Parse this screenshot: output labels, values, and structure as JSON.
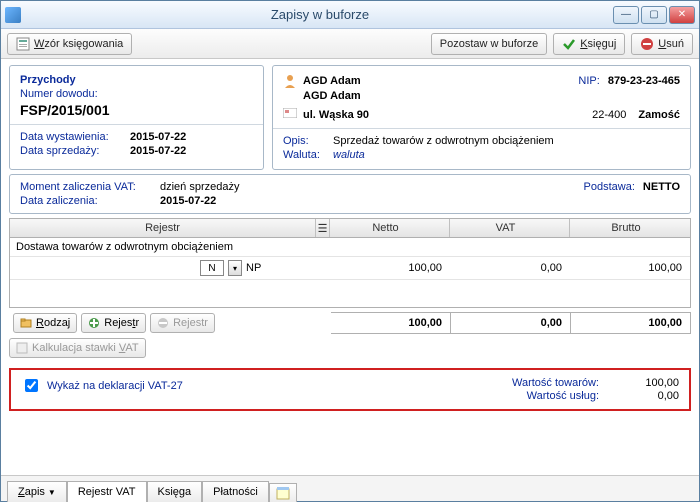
{
  "window": {
    "title": "Zapisy w buforze"
  },
  "toolbar": {
    "wzor": "Wzór księgowania",
    "pozostaw": "Pozostaw w buforze",
    "ksieguj": "Księguj",
    "usun": "Usuń"
  },
  "left_panel": {
    "przychody": "Przychody",
    "numer_label": "Numer dowodu:",
    "numer_value": "FSP/2015/001",
    "data_wyst_label": "Data wystawienia:",
    "data_wyst_value": "2015-07-22",
    "data_sprz_label": "Data sprzedaży:",
    "data_sprz_value": "2015-07-22"
  },
  "right_panel": {
    "name1": "AGD Adam",
    "nip_label": "NIP:",
    "nip_value": "879-23-23-465",
    "name2": "AGD Adam",
    "street": "ul. Wąska 90",
    "zip": "22-400",
    "city": "Zamość",
    "opis_label": "Opis:",
    "opis_value": "Sprzedaż towarów z odwrotnym obciążeniem",
    "waluta_label": "Waluta:",
    "waluta_value": "waluta"
  },
  "vat_panel": {
    "moment_label": "Moment zaliczenia VAT:",
    "moment_value": "dzień sprzedaży",
    "podstawa_label": "Podstawa:",
    "podstawa_value": "NETTO",
    "data_zal_label": "Data zaliczenia:",
    "data_zal_value": "2015-07-22"
  },
  "grid": {
    "headers": {
      "rejestr": "Rejestr",
      "netto": "Netto",
      "vat": "VAT",
      "brutto": "Brutto"
    },
    "row_desc": "Dostawa towarów z odwrotnym obciążeniem",
    "code_input": "N",
    "code_label": "NP",
    "netto": "100,00",
    "vat": "0,00",
    "brutto": "100,00",
    "totals": {
      "netto": "100,00",
      "vat": "0,00",
      "brutto": "100,00"
    },
    "buttons": {
      "rodzaj": "Rodzaj",
      "rejestr_add": "Rejestr",
      "rejestr_del": "Rejestr",
      "kalkulacja": "Kalkulacja stawki VAT"
    }
  },
  "vat27": {
    "checkbox_label": "Wykaż na deklaracji VAT-27",
    "towary_label": "Wartość towarów:",
    "towary_value": "100,00",
    "uslugi_label": "Wartość usług:",
    "uslugi_value": "0,00"
  },
  "tabs": {
    "zapis": "Zapis",
    "rejestr_vat": "Rejestr VAT",
    "ksiega": "Księga",
    "platnosci": "Płatności"
  }
}
